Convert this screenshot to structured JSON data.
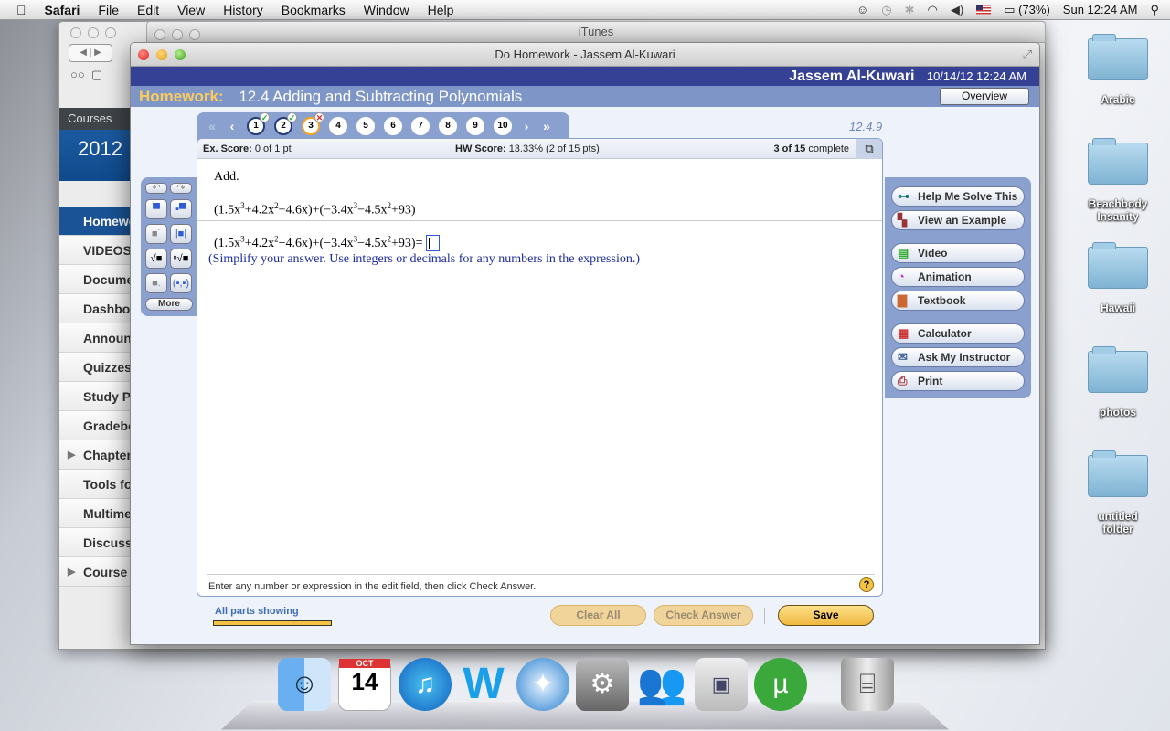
{
  "menubar": {
    "app": "Safari",
    "items": [
      "File",
      "Edit",
      "View",
      "History",
      "Bookmarks",
      "Window",
      "Help"
    ],
    "battery": "(73%)",
    "clock": "Sun 12:24 AM",
    "icons": [
      "evernote-icon",
      "time-machine-icon",
      "bluetooth-icon",
      "wifi-icon",
      "volume-icon",
      "us-flag-icon",
      "battery-icon",
      "spotlight-icon"
    ]
  },
  "itunes": {
    "title": "iTunes"
  },
  "safari": {
    "courses": "Courses",
    "year": "2012",
    "nav": [
      {
        "label": "Homework",
        "active": true
      },
      {
        "label": "VIDEOS"
      },
      {
        "label": "Documents"
      },
      {
        "label": "Dashboard"
      },
      {
        "label": "Announcements"
      },
      {
        "label": "Quizzes"
      },
      {
        "label": "Study Plan"
      },
      {
        "label": "Gradebook"
      },
      {
        "label": "Chapter",
        "arrow": true
      },
      {
        "label": "Tools for"
      },
      {
        "label": "Multimedia"
      },
      {
        "label": "Discussion"
      },
      {
        "label": "Course",
        "arrow": true
      }
    ]
  },
  "window": {
    "title": "Do Homework - Jassem Al-Kuwari"
  },
  "header": {
    "user": "Jassem Al-Kuwari",
    "datetime": "10/14/12 12:24 AM"
  },
  "homework": {
    "label": "Homework:",
    "title": "12.4 Adding and Subtracting Polynomials",
    "overview": "Overview"
  },
  "question_nav": {
    "questions": [
      {
        "n": "1",
        "status": "correct"
      },
      {
        "n": "2",
        "status": "correct"
      },
      {
        "n": "3",
        "status": "incorrect",
        "current": true
      },
      {
        "n": "4"
      },
      {
        "n": "5"
      },
      {
        "n": "6"
      },
      {
        "n": "7"
      },
      {
        "n": "8"
      },
      {
        "n": "9"
      },
      {
        "n": "10"
      }
    ],
    "code": "12.4.9"
  },
  "score": {
    "ex_label": "Ex. Score:",
    "ex_value": "0 of 1 pt",
    "hw_label": "HW Score:",
    "hw_value": "13.33% (2 of 15 pts)",
    "progress_bold": "3 of 15",
    "progress_text": "complete"
  },
  "question": {
    "instruction": "Add.",
    "expression": [
      [
        "(1.5x",
        ""
      ],
      [
        "",
        "3"
      ],
      [
        "+4.2x",
        ""
      ],
      [
        "",
        "2"
      ],
      [
        "−4.6x)+(−3.4x",
        ""
      ],
      [
        "",
        "3"
      ],
      [
        "−4.5x",
        ""
      ],
      [
        "",
        "2"
      ],
      [
        "+93)",
        ""
      ]
    ],
    "equals": "=",
    "answer": "",
    "hint": "(Simplify your answer. Use integers or decimals for any numbers in the expression.)"
  },
  "footer_text": "Enter any number or expression in the edit field, then click Check Answer.",
  "palette": {
    "more": "More"
  },
  "tools": [
    {
      "label": "Help Me Solve This",
      "icon": "key-icon"
    },
    {
      "label": "View an Example",
      "icon": "binoculars-icon"
    },
    {
      "label": "Video",
      "icon": "film-icon"
    },
    {
      "label": "Animation",
      "icon": "animation-icon"
    },
    {
      "label": "Textbook",
      "icon": "book-icon"
    },
    {
      "label": "Calculator",
      "icon": "calculator-icon"
    },
    {
      "label": "Ask My Instructor",
      "icon": "instructor-icon"
    },
    {
      "label": "Print",
      "icon": "printer-icon"
    }
  ],
  "bottom": {
    "parts": "All parts showing",
    "parts_progress": 1.0,
    "clear": "Clear All",
    "check": "Check Answer",
    "save": "Save"
  },
  "desktop": {
    "folders": [
      "Arabic",
      "Beachbody Insanity",
      "Hawaii",
      "photos",
      "untitled folder"
    ]
  },
  "dock": {
    "calendar_month": "OCT",
    "calendar_day": "14",
    "apps": [
      "finder-icon",
      "calendar-icon",
      "itunes-icon",
      "word-icon",
      "safari-icon",
      "system-preferences-icon",
      "messenger-icon",
      "gameboy-emulator-icon",
      "utorrent-icon",
      "trash-icon"
    ]
  },
  "colors": {
    "header": "#354194",
    "homework_bar": "#7d96c7",
    "accent_yellow": "#fccb5d",
    "panel_blue": "#8aa1cf"
  }
}
